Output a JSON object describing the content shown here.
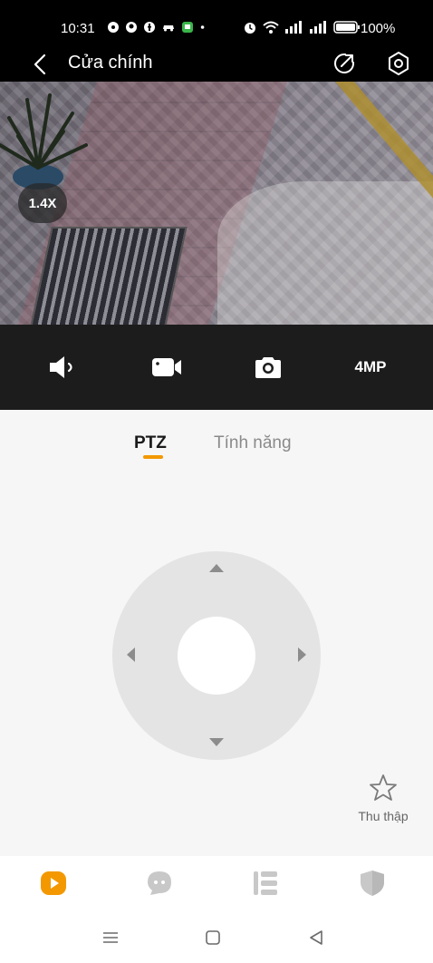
{
  "status_bar": {
    "time": "10:31",
    "battery": "100%"
  },
  "header": {
    "title": "Cửa chính"
  },
  "video": {
    "zoom": "1.4X"
  },
  "controls": {
    "resolution": "4MP"
  },
  "tabs": [
    {
      "label": "PTZ",
      "active": true
    },
    {
      "label": "Tính năng",
      "active": false
    }
  ],
  "favorite": {
    "label": "Thu thập"
  },
  "colors": {
    "accent": "#f39800",
    "panel_bg": "#f6f6f6",
    "joystick_bg": "#e4e4e4"
  },
  "bottom_nav": {
    "items": [
      {
        "icon": "play-icon",
        "active": true
      },
      {
        "icon": "chat-icon",
        "active": false
      },
      {
        "icon": "list-icon",
        "active": false
      },
      {
        "icon": "shield-icon",
        "active": false
      }
    ]
  }
}
